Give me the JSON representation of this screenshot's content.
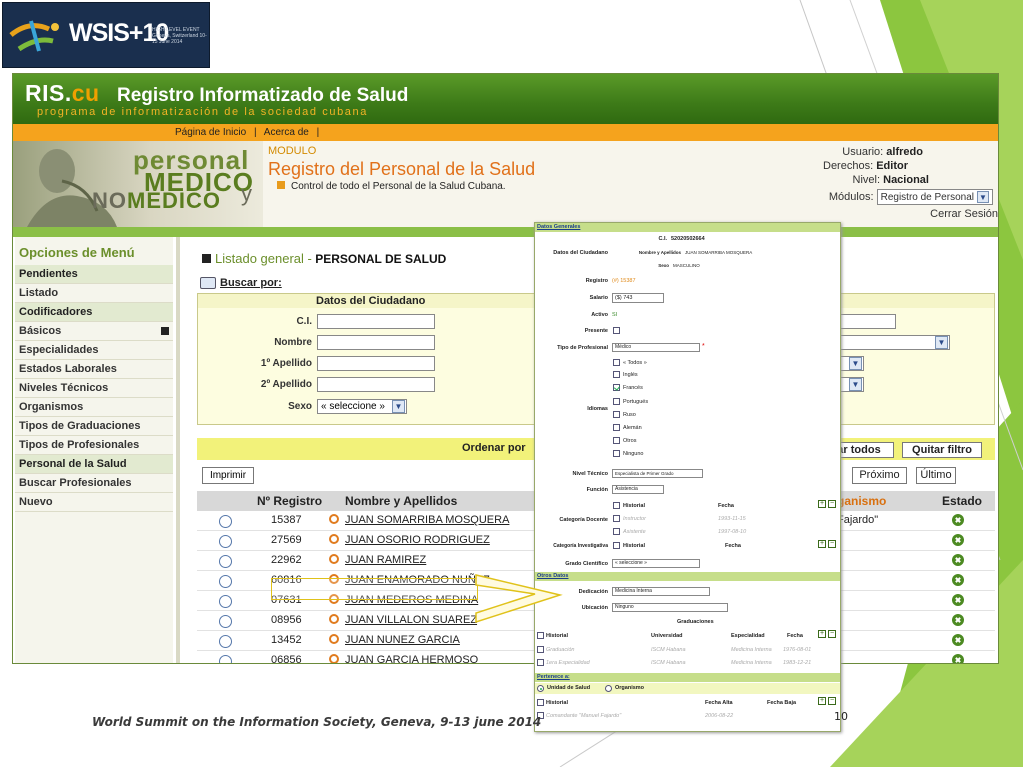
{
  "slide": {
    "logo_text": "WSIS+10",
    "logo_sub": "HIGH-LEVEL EVENT Geneva, Switzerland 10-13 June 2014",
    "footer": "World Summit on the Information Society, Geneva, 9-13 june 2014",
    "page_number": "10",
    "colors": {
      "accent_green": "#8cc63f",
      "dark_green": "#3d7a18",
      "orange": "#f5a31d"
    }
  },
  "app": {
    "brand_ris": "RIS.",
    "brand_cu": "cu",
    "title": "Registro Informatizado de Salud",
    "subtitle": "programa de informatización de la sociedad cubana"
  },
  "topnav": {
    "items": [
      "Página de Inicio",
      "|",
      "Acerca de",
      "|"
    ]
  },
  "banner": {
    "personal": "personal",
    "medico": "MEDICO",
    "nomedico_no": "NO",
    "nomedico_medico": "MEDICO",
    "y": "y",
    "modulo_label": "MODULO",
    "title": "Registro del Personal de la Salud",
    "description": "Control de todo el Personal de la Salud Cubana."
  },
  "user": {
    "usuario_label": "Usuario:",
    "usuario": "alfredo",
    "derechos_label": "Derechos:",
    "derechos": "Editor",
    "nivel_label": "Nivel:",
    "nivel": "Nacional",
    "modulos_label": "Módulos:",
    "modulo_selected": "Registro de Personal",
    "logout": "Cerrar Sesión"
  },
  "sidebar": {
    "heading": "Opciones de Menú",
    "items": [
      {
        "label": "Pendientes",
        "group": true
      },
      {
        "label": "Listado",
        "group": false
      },
      {
        "label": "Codificadores",
        "group": true
      },
      {
        "label": "Básicos",
        "group": false
      },
      {
        "label": "Especialidades",
        "group": false
      },
      {
        "label": "Estados Laborales",
        "group": false
      },
      {
        "label": "Niveles Técnicos",
        "group": false
      },
      {
        "label": "Organismos",
        "group": false
      },
      {
        "label": "Tipos de Graduaciones",
        "group": false
      },
      {
        "label": "Tipos de Profesionales",
        "group": false
      },
      {
        "label": "Personal de la Salud",
        "group": true
      },
      {
        "label": "Buscar Profesionales",
        "group": false
      },
      {
        "label": "Nuevo",
        "group": false
      }
    ]
  },
  "main": {
    "listado_prefix": "Listado general -",
    "listado_title": "PERSONAL DE SALUD",
    "buscar": "Buscar por:",
    "panel_title": "Datos del Ciudadano",
    "fields": [
      "C.I.",
      "Nombre",
      "1º Apellido",
      "2º Apellido",
      "Sexo"
    ],
    "sexo_value": "« seleccione »",
    "ordenar": "Ordenar por",
    "limpiar": "ar todos",
    "quitar": "Quitar filtro",
    "imprimir": "Imprimir",
    "proximo": "Próximo",
    "ultimo": "Último",
    "columns": {
      "registro": "Nº Registro",
      "nombre": "Nombre y Apellidos",
      "organismo": "ganismo",
      "estado": "Estado"
    },
    "rows": [
      {
        "registro": "15387",
        "nombre": "JUAN SOMARRIBA MOSQUERA",
        "organismo": "Fajardo\""
      },
      {
        "registro": "27569",
        "nombre": "JUAN OSORIO RODRIGUEZ",
        "organismo": ""
      },
      {
        "registro": "22962",
        "nombre": "JUAN RAMIREZ",
        "organismo": ""
      },
      {
        "registro": "60816",
        "nombre": "JUAN ENAMORADO NUÑEZ",
        "organismo": ""
      },
      {
        "registro": "07631",
        "nombre": "JUAN MEDEROS MEDINA",
        "organismo": ""
      },
      {
        "registro": "08956",
        "nombre": "JUAN VILLALON SUAREZ",
        "organismo": ""
      },
      {
        "registro": "13452",
        "nombre": "JUAN NUNEZ GARCIA",
        "organismo": ""
      },
      {
        "registro": "06856",
        "nombre": "JUAN GARCIA HERMOSO",
        "organismo": ""
      }
    ]
  },
  "popup": {
    "sec_generales": "Datos Generales",
    "ci_label": "C.I.",
    "ci_value": "52020502664",
    "datos_ciudadano": "Datos del Ciudadano",
    "nombre_label": "Nombre y Apellidos",
    "nombre_value": "JUAN SOMARRIBA MOSQUERA",
    "sexo_label": "Sexo",
    "sexo_value": "MASCULINO",
    "registro_label": "Registro",
    "registro_value": "(#) 15387",
    "salario_label": "Salario",
    "salario_value": "($) 743",
    "activo_label": "Activo",
    "activo_value": "SI",
    "presente_label": "Presente",
    "tipo_label": "Tipo de Profesional",
    "tipo_value": "Médico",
    "idiomas_label": "Idiomas",
    "idiomas": [
      {
        "label": "« Todos »",
        "checked": false
      },
      {
        "label": "Inglés",
        "checked": false
      },
      {
        "label": "Francés",
        "checked": true
      },
      {
        "label": "Portugués",
        "checked": false
      },
      {
        "label": "Ruso",
        "checked": false
      },
      {
        "label": "Alemán",
        "checked": false
      },
      {
        "label": "Otros",
        "checked": false
      },
      {
        "label": "Ninguno",
        "checked": false
      }
    ],
    "nivel_label": "Nivel Técnico",
    "nivel_value": "Especialista de Primer Grado",
    "funcion_label": "Función",
    "funcion_value": "Asistencia",
    "catdoc_label": "Categoría Docente",
    "historial": "Historial",
    "fecha": "Fecha",
    "catdoc_rows": [
      {
        "cat": "Instructor",
        "fecha": "1993-11-15"
      },
      {
        "cat": "Asistente",
        "fecha": "1997-08-10"
      }
    ],
    "catinv_label": "Categoría Investigativa",
    "grado_label": "Grado Científico",
    "grado_value": "« seleccione »",
    "sec_otros": "Otros Datos",
    "dedicacion_label": "Dedicación",
    "dedicacion_value": "Medicina Interna",
    "ubicacion_label": "Ubicación",
    "ubicacion_value": "Ninguno",
    "graduaciones": "Graduaciones",
    "grad_cols": {
      "universidad": "Universidad",
      "especialidad": "Especialidad",
      "fecha": "Fecha"
    },
    "grad_rows": [
      {
        "tipo": "Graduación",
        "univ": "ISCM Habana",
        "esp": "Medicina Interna",
        "fecha": "1976-08-01"
      },
      {
        "tipo": "1era Especialidad",
        "univ": "ISCM Habana",
        "esp": "Medicina Interna",
        "fecha": "1983-12-21"
      }
    ],
    "sec_pertenece": "Pertenece a:",
    "unidad_label": "Unidad de Salud",
    "organismo_label": "Organismo",
    "fecha_alta": "Fecha Alta",
    "fecha_baja": "Fecha Baja",
    "pert_row_name": "Comandante \"Manuel Fajardo\"",
    "pert_row_alta": "2006-08-22"
  }
}
